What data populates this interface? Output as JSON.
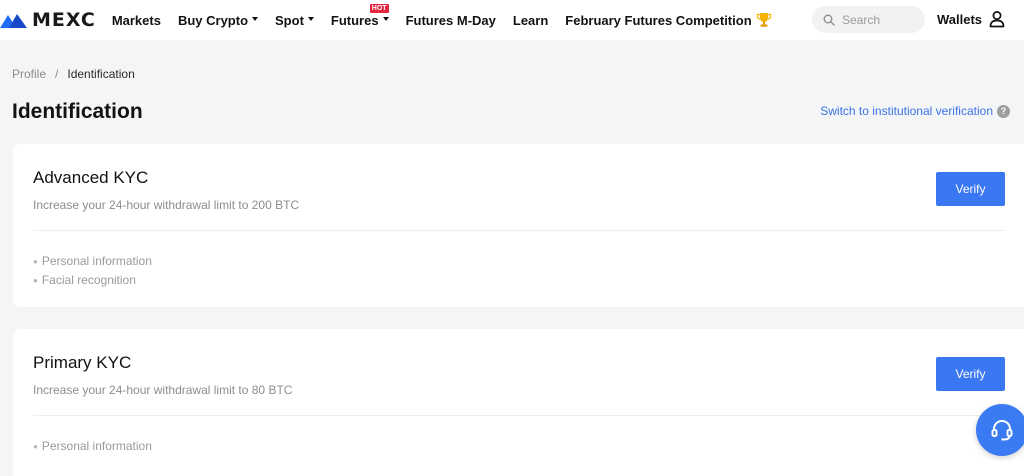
{
  "brand": {
    "name": "MEXC"
  },
  "nav": {
    "items": [
      {
        "label": "Markets",
        "has_caret": false
      },
      {
        "label": "Buy Crypto",
        "has_caret": true
      },
      {
        "label": "Spot",
        "has_caret": true
      },
      {
        "label": "Futures",
        "has_caret": true,
        "badge": "HOT"
      },
      {
        "label": "Futures M-Day",
        "has_caret": false
      },
      {
        "label": "Learn",
        "has_caret": false
      },
      {
        "label": "February Futures Competition",
        "has_caret": false,
        "icon": "trophy-icon"
      }
    ],
    "search_placeholder": "Search",
    "wallets_label": "Wallets"
  },
  "breadcrumb": {
    "parent": "Profile",
    "separator": "/",
    "current": "Identification"
  },
  "page": {
    "title": "Identification",
    "institutional_link": "Switch to institutional verification",
    "help_icon": "?"
  },
  "kyc_cards": [
    {
      "title": "Advanced KYC",
      "subtitle": "Increase your 24-hour withdrawal limit to 200 BTC",
      "button": "Verify",
      "features": [
        "Personal information",
        "Facial recognition"
      ]
    },
    {
      "title": "Primary KYC",
      "subtitle": "Increase your 24-hour withdrawal limit to 80 BTC",
      "button": "Verify",
      "features": [
        "Personal information"
      ]
    }
  ],
  "colors": {
    "accent": "#3a77f3",
    "link": "#3b73e6",
    "hot_badge": "#e6253f",
    "background": "#f4f5f7"
  }
}
